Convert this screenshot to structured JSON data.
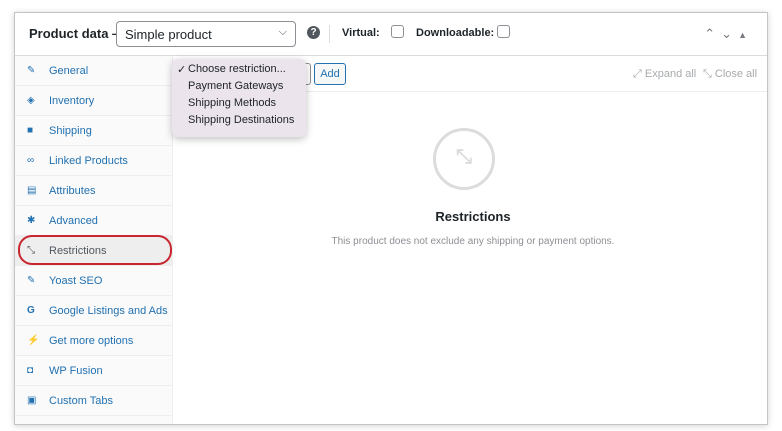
{
  "header": {
    "title": "Product data —",
    "product_type": "Simple product",
    "help_glyph": "?",
    "virtual_label": "Virtual:",
    "downloadable_label": "Downloadable:",
    "virtual_checked": false,
    "downloadable_checked": false
  },
  "tabs": [
    {
      "label": "General",
      "icon": "wrench-icon",
      "glyph": "✎"
    },
    {
      "label": "Inventory",
      "icon": "tag-icon",
      "glyph": "◈"
    },
    {
      "label": "Shipping",
      "icon": "truck-icon",
      "glyph": "■"
    },
    {
      "label": "Linked Products",
      "icon": "link-icon",
      "glyph": "∞"
    },
    {
      "label": "Attributes",
      "icon": "list-icon",
      "glyph": "▤"
    },
    {
      "label": "Advanced",
      "icon": "gear-icon",
      "glyph": "✱"
    },
    {
      "label": "Restrictions",
      "icon": "restrictions-icon",
      "glyph": "⤡"
    },
    {
      "label": "Yoast SEO",
      "icon": "yoast-icon",
      "glyph": "✎"
    },
    {
      "label": "Google Listings and Ads",
      "icon": "google-icon",
      "glyph": "G"
    },
    {
      "label": "Get more options",
      "icon": "plug-icon",
      "glyph": "⚡"
    },
    {
      "label": "WP Fusion",
      "icon": "wpfusion-icon",
      "glyph": "◘"
    },
    {
      "label": "Custom Tabs",
      "icon": "custom-tabs-icon",
      "glyph": "▣"
    }
  ],
  "toolbar": {
    "add_label": "Add",
    "expand_all": "Expand all",
    "close_all": "Close all"
  },
  "dropdown": {
    "selected": "Choose restriction...",
    "options": [
      "Choose restriction...",
      "Payment Gateways",
      "Shipping Methods",
      "Shipping Destinations"
    ]
  },
  "empty_state": {
    "title": "Restrictions",
    "message": "This product does not exclude any shipping or payment options."
  },
  "colors": {
    "link": "#2271b1",
    "highlight_ring": "#c7262e",
    "dropdown_bg": "#ebe4ec"
  }
}
